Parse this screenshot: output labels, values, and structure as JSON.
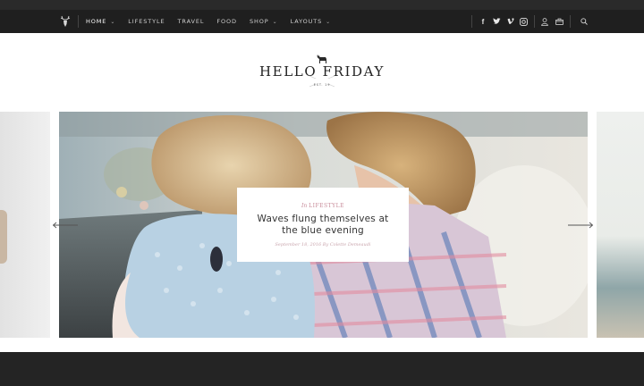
{
  "nav": {
    "items": [
      {
        "label": "Home",
        "has_dropdown": true,
        "active": true
      },
      {
        "label": "Lifestyle",
        "has_dropdown": false,
        "active": false
      },
      {
        "label": "Travel",
        "has_dropdown": false,
        "active": false
      },
      {
        "label": "Food",
        "has_dropdown": false,
        "active": false
      },
      {
        "label": "Shop",
        "has_dropdown": true,
        "active": false
      },
      {
        "label": "Layouts",
        "has_dropdown": true,
        "active": false
      }
    ],
    "social": [
      "facebook-icon",
      "twitter-icon",
      "vimeo-icon",
      "instagram-icon"
    ],
    "tools": [
      "user-icon",
      "cart-icon",
      "search-icon"
    ],
    "colors": {
      "bar": "#1f1f1f",
      "text": "#cfcfcf",
      "active": "#ffffff"
    }
  },
  "header": {
    "brand_name": "HELLO FRIDAY",
    "brand_tagline": "EST. 19"
  },
  "slider": {
    "current": {
      "category_prefix": "In",
      "category": "LIFESTYLE",
      "title": "Waves flung themselves at the blue evening",
      "meta": "September 18, 2016 By Colette Demeaudi"
    },
    "accent_color": "#c88c9a"
  }
}
